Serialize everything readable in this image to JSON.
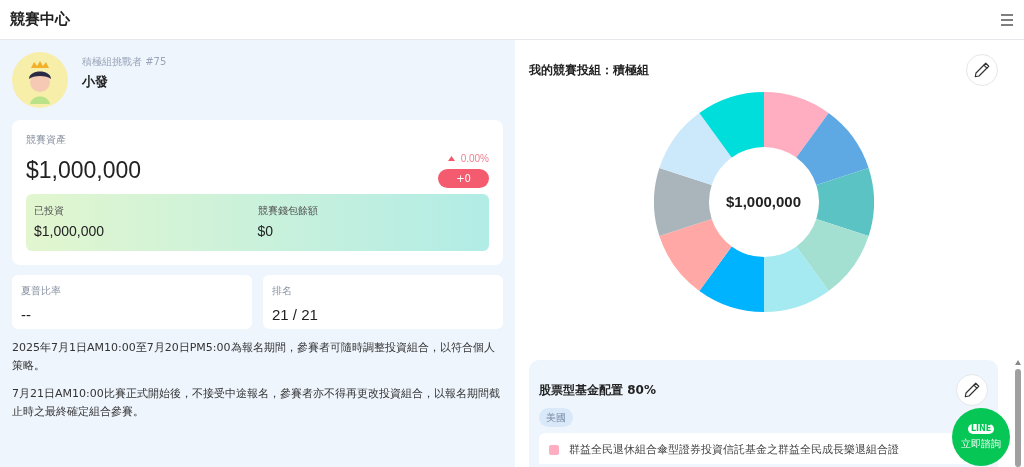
{
  "header": {
    "title": "競賽中心"
  },
  "profile": {
    "subtitle": "積極組挑戰者 #75",
    "name": "小發"
  },
  "assets": {
    "label": "競賽資產",
    "value": "$1,000,000",
    "change_percent": "0.00%",
    "change_amount": "+0",
    "invested_label": "已投資",
    "invested_value": "$1,000,000",
    "wallet_label": "競賽錢包餘額",
    "wallet_value": "$0"
  },
  "stats": [
    {
      "label": "夏普比率",
      "value": "--"
    },
    {
      "label": "排名",
      "value": "21 / 21"
    }
  ],
  "notes": [
    "2025年7月1日AM10:00至7月20日PM5:00為報名期間，參賽者可隨時調整投資組合，以符合個人策略。",
    "7月21日AM10:00比賽正式開始後，不接受中途報名，參賽者亦不得再更改投資組合，以報名期間截止時之最終確定組合參賽。"
  ],
  "portfolio": {
    "title": "我的競賽投組：積極組",
    "center_value": "$1,000,000",
    "slices": [
      {
        "color": "#ffadc0"
      },
      {
        "color": "#5ea8e4"
      },
      {
        "color": "#5cc3c5"
      },
      {
        "color": "#a3e0d2"
      },
      {
        "color": "#a4eaf0"
      },
      {
        "color": "#00b3ff"
      },
      {
        "color": "#ffa8a5"
      },
      {
        "color": "#a9b4bb"
      },
      {
        "color": "#cce9fc"
      },
      {
        "color": "#00dedc"
      }
    ]
  },
  "allocation": {
    "title": "股票型基金配置 80%",
    "region_tag": "美國",
    "funds": [
      {
        "name": "群益全民退休組合傘型證券投資信託基金之群益全民成長樂退組合證",
        "color": "#ffadc0"
      }
    ]
  },
  "line_button": {
    "logo": "LINE",
    "label": "立即諮詢"
  }
}
